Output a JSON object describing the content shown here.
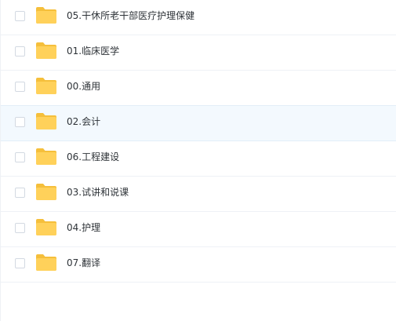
{
  "folder_color": "#ffd15a",
  "folder_tab_color": "#f5bf3b",
  "hover_row_color": "#f3f9fe",
  "files": [
    {
      "name": "05.干休所老干部医疗护理保健",
      "icon": "folder-icon",
      "checked": false
    },
    {
      "name": "01.临床医学",
      "icon": "folder-icon",
      "checked": false
    },
    {
      "name": "00.通用",
      "icon": "folder-icon",
      "checked": false
    },
    {
      "name": "02.会计",
      "icon": "folder-icon",
      "checked": false,
      "hovered": true
    },
    {
      "name": "06.工程建设",
      "icon": "folder-icon",
      "checked": false
    },
    {
      "name": "03.试讲和说课",
      "icon": "folder-icon",
      "checked": false
    },
    {
      "name": "04.护理",
      "icon": "folder-icon",
      "checked": false
    },
    {
      "name": "07.翻译",
      "icon": "folder-icon",
      "checked": false
    }
  ]
}
